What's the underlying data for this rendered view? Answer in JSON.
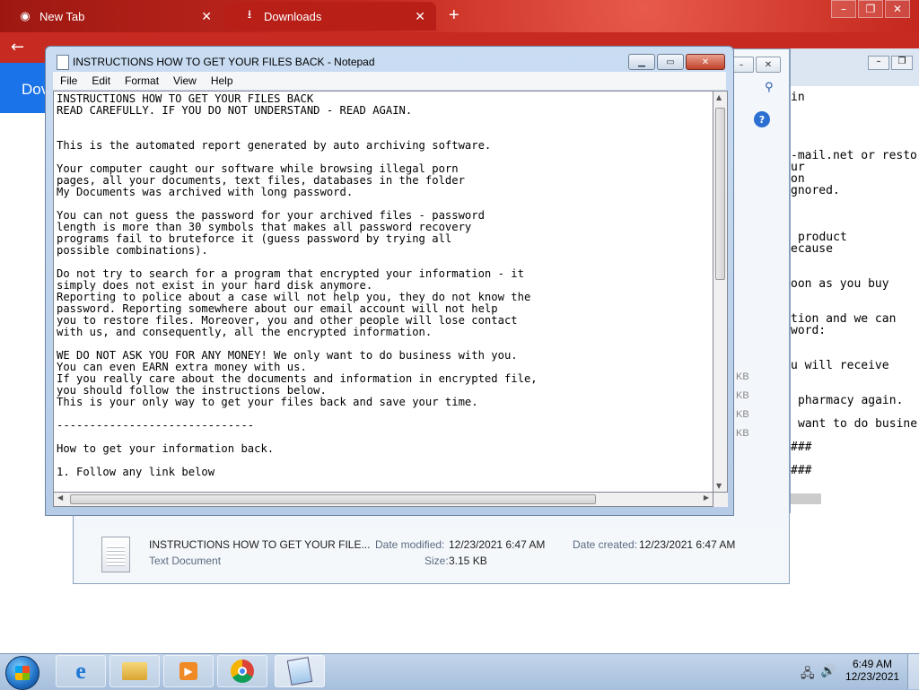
{
  "browser": {
    "tabs": [
      {
        "label": "New Tab",
        "icon": "chrome-icon"
      },
      {
        "label": "Downloads",
        "icon": "download-icon"
      }
    ],
    "page_header": "Dov"
  },
  "notepad": {
    "title": "INSTRUCTIONS HOW TO GET YOUR FILES BACK - Notepad",
    "menu": [
      "File",
      "Edit",
      "Format",
      "View",
      "Help"
    ],
    "lines": [
      "INSTRUCTIONS HOW TO GET YOUR FILES BACK",
      "READ CAREFULLY. IF YOU DO NOT UNDERSTAND - READ AGAIN.",
      "",
      "",
      "This is the automated report generated by auto archiving software.",
      "",
      "Your computer caught our software while browsing illegal porn",
      "pages, all your documents, text files, databases in the folder",
      "My Documents was archived with long password.",
      "",
      "You can not guess the password for your archived files - password",
      "length is more than 30 symbols that makes all password recovery",
      "programs fail to bruteforce it (guess password by trying all",
      "possible combinations).",
      "",
      "Do not try to search for a program that encrypted your information - it",
      "simply does not exist in your hard disk anymore.",
      "Reporting to police about a case will not help you, they do not know the",
      "password. Reporting somewhere about our email account will not help",
      "you to restore files. Moreover, you and other people will lose contact",
      "with us, and consequently, all the encrypted information.",
      "",
      "WE DO NOT ASK YOU FOR ANY MONEY! We only want to do business with you.",
      "You can even EARN extra money with us.",
      "If you really care about the documents and information in encrypted file,",
      "you should follow the instructions below.",
      "This is your only way to get your files back and save your time.",
      "",
      "------------------------------",
      "",
      "How to get your information back.",
      "",
      "1. Follow any link below"
    ]
  },
  "background_window": {
    "text_fragments": [
      "in",
      "-mail.net or resto",
      "ur",
      "on",
      "gnored.",
      "product",
      "ecause",
      "oon as you buy",
      "tion and we can",
      "word:",
      "u will receive",
      "pharmacy again.",
      "want to do busine",
      "###",
      "###"
    ],
    "size_fragments": [
      "KB",
      "KB",
      "KB",
      "KB"
    ]
  },
  "file_details": {
    "name": "INSTRUCTIONS HOW TO GET YOUR FILE...",
    "type": "Text Document",
    "date_modified_label": "Date modified:",
    "date_modified": "12/23/2021 6:47 AM",
    "date_created_label": "Date created:",
    "date_created": "12/23/2021 6:47 AM",
    "size_label": "Size:",
    "size": "3.15 KB"
  },
  "taskbar": {
    "items": [
      "internet-explorer-icon",
      "folder-icon",
      "media-player-icon",
      "chrome-icon",
      "notepad-icon"
    ],
    "time": "6:49 AM",
    "date": "12/23/2021"
  }
}
